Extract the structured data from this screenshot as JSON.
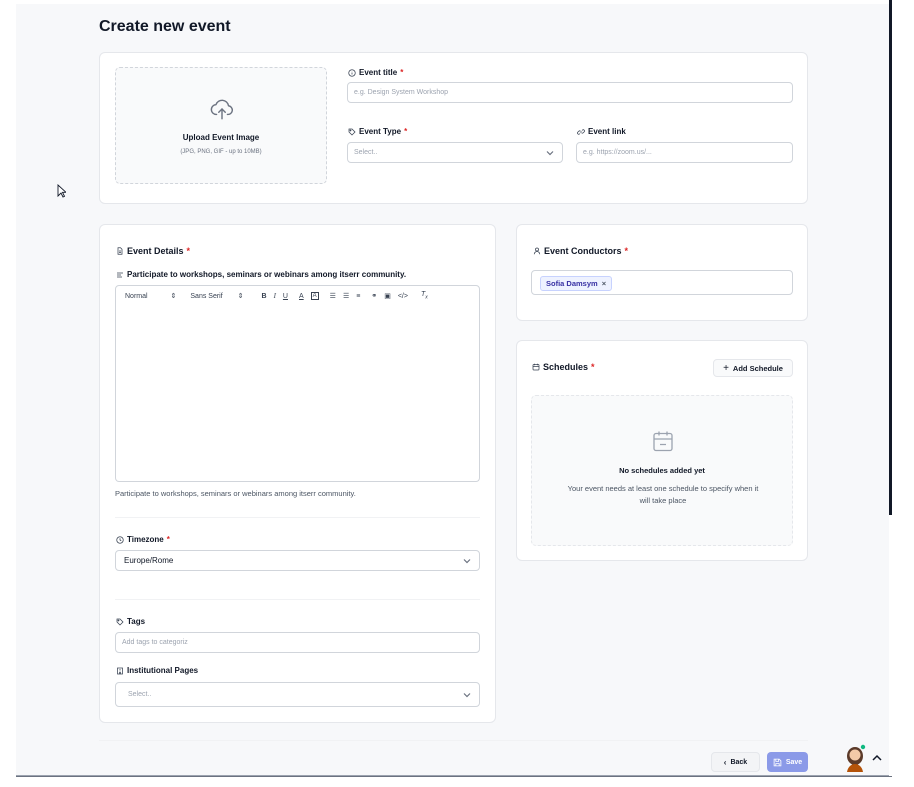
{
  "page": {
    "title": "Create new event"
  },
  "upload": {
    "label": "Upload Event Image",
    "hint": "(JPG, PNG, GIF - up to 10MB)",
    "icon": "cloud-upload-icon"
  },
  "event_title": {
    "label": "Event title",
    "required": "*",
    "placeholder": "e.g. Design System Workshop"
  },
  "event_type": {
    "label": "Event Type",
    "required": "*",
    "placeholder": "Select.."
  },
  "event_link": {
    "label": "Event link",
    "placeholder": "e.g. https://zoom.us/..."
  },
  "details": {
    "label": "Event Details",
    "required": "*",
    "subtitle": "Participate to workshops, seminars or webinars among itserr community.",
    "toolbar": {
      "format": "Normal",
      "font": "Sans Serif"
    },
    "helper": "Participate to workshops, seminars or webinars among itserr community."
  },
  "timezone": {
    "label": "Timezone",
    "required": "*",
    "value": "Europe/Rome"
  },
  "tags": {
    "label": "Tags",
    "placeholder": "Add tags to categoriz"
  },
  "institutional": {
    "label": "Institutional Pages",
    "placeholder": "Select.."
  },
  "conductors": {
    "label": "Event Conductors",
    "required": "*",
    "chip": "Sofia Damsym",
    "chip_remove": "×"
  },
  "schedules": {
    "label": "Schedules",
    "required": "*",
    "add_button": "Add Schedule",
    "empty_title": "No schedules added yet",
    "empty_desc": "Your event needs at least one schedule to specify when it will take place"
  },
  "footer": {
    "back": "Back",
    "save": "Save"
  },
  "colors": {
    "accent": "#8b9ae8",
    "required": "#dc2626",
    "chip_bg": "#eef2ff"
  }
}
